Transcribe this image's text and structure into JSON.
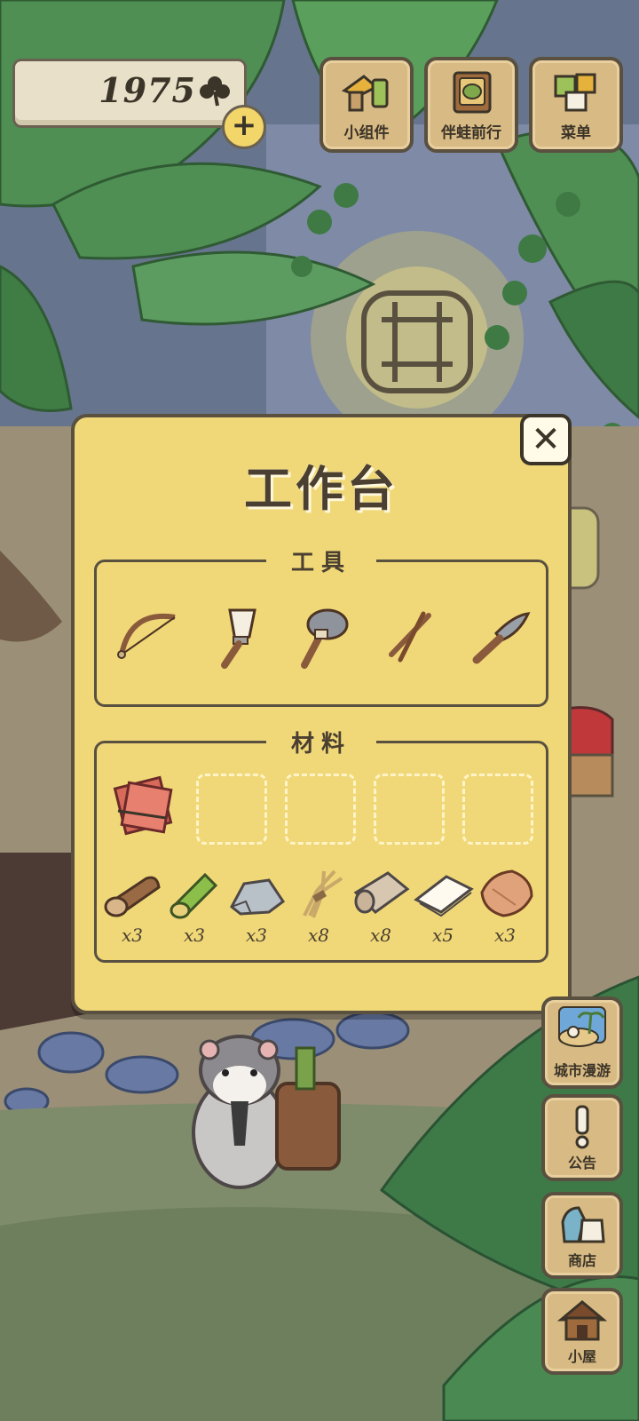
{
  "currency": {
    "clover_count": "1975",
    "icon": "clover-icon",
    "add_icon": "plus-icon"
  },
  "top_menu": {
    "widgets_label": "小组件",
    "companion_label": "伴蛙前行",
    "menu_label": "菜单"
  },
  "workbench": {
    "title": "工作台",
    "close_icon": "close-icon",
    "tools_label": "工具",
    "tools": [
      "bow-icon",
      "brush-icon",
      "stone-hammer-icon",
      "sticks-icon",
      "knife-icon"
    ],
    "materials_label": "材料",
    "selected_material_icon": "paper-charm-icon",
    "materials": [
      {
        "icon": "wood-log-icon",
        "qty": "x3"
      },
      {
        "icon": "bamboo-icon",
        "qty": "x3"
      },
      {
        "icon": "stone-icon",
        "qty": "x3"
      },
      {
        "icon": "straw-icon",
        "qty": "x8"
      },
      {
        "icon": "cloth-icon",
        "qty": "x8"
      },
      {
        "icon": "paper-icon",
        "qty": "x5"
      },
      {
        "icon": "leather-icon",
        "qty": "x3"
      }
    ]
  },
  "side_menu": {
    "city_trip_label": "城市漫游",
    "notice_label": "公告",
    "shop_label": "商店",
    "hut_label": "小屋"
  },
  "colors": {
    "panel_bg": "#f0d878",
    "button_bg": "#d8ba84",
    "outline": "#5a5040",
    "plus_bg": "#f2d66a"
  }
}
